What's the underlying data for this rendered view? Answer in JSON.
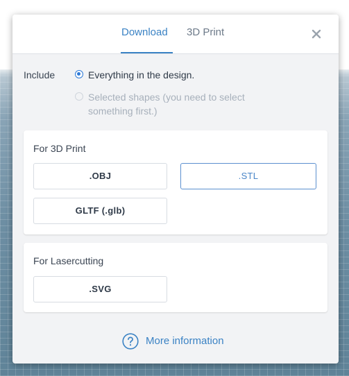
{
  "tabs": {
    "download": "Download",
    "print3d": "3D Print"
  },
  "include": {
    "label": "Include",
    "option_everything": "Everything in the design.",
    "option_selected": "Selected shapes (you need to select something first.)"
  },
  "section_3d": {
    "title": "For 3D Print",
    "obj": ".OBJ",
    "stl": ".STL",
    "gltf": "GLTF (.glb)"
  },
  "section_laser": {
    "title": "For Lasercutting",
    "svg": ".SVG"
  },
  "footer": {
    "more_info": "More information"
  },
  "icons": {
    "close": "close-icon",
    "help": "help-circle-icon"
  },
  "colors": {
    "accent": "#3a82c4",
    "radio_selected": "#2d7ad8",
    "dialog_bg": "#f2f3f5"
  },
  "state": {
    "active_tab": "Download",
    "selected_include": "Everything in the design.",
    "highlighted_format": ".STL"
  }
}
